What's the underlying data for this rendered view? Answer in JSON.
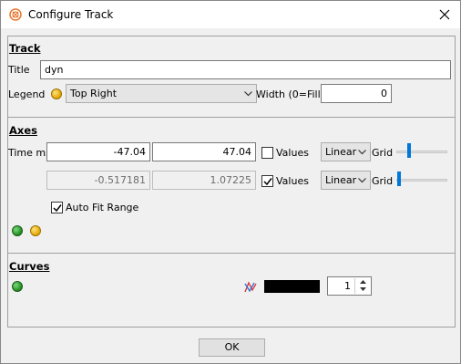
{
  "window": {
    "title": "Configure Track"
  },
  "track": {
    "section_label": "Track",
    "title_label": "Title",
    "title_value": "dyn",
    "legend_label": "Legend",
    "legend_value": "Top Right",
    "width_label": "Width (0=Fill)",
    "width_value": "0"
  },
  "axes": {
    "section_label": "Axes",
    "x_axis_label": "Time ms",
    "x_min": "-47.04",
    "x_max": "47.04",
    "x_values_label": "Values",
    "x_values_checked": false,
    "x_scale": "Linear",
    "x_grid_label": "Grid",
    "x_grid_level": 0.05,
    "y_min": "-0.517181",
    "y_max": "1.07225",
    "y_values_label": "Values",
    "y_values_checked": true,
    "y_scale": "Linear",
    "y_grid_label": "Grid",
    "y_grid_level": 0.0,
    "auto_fit_label": "Auto Fit Range",
    "auto_fit_checked": true
  },
  "curves": {
    "section_label": "Curves",
    "line_color": "#000000",
    "line_width": "1"
  },
  "buttons": {
    "ok_label": "OK"
  },
  "colors": {
    "accent": "#0078d7",
    "status_green": "#1e8a1e",
    "status_yellow": "#e2a400",
    "title_icon": "#e8772e"
  },
  "icons": {
    "app": "target-icon",
    "close": "close-icon",
    "legend_marker": "yellow-dot-icon",
    "curve_style": "curve-style-icon"
  }
}
